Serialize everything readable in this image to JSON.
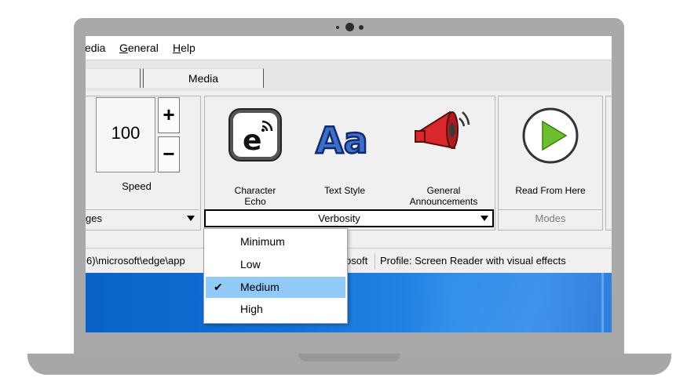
{
  "menu": [
    "edia",
    "General",
    "Help"
  ],
  "menu_underlines": [
    "",
    "G",
    "H"
  ],
  "menu_rest": [
    "edia",
    "eneral",
    "elp"
  ],
  "tabs": [
    "",
    "Media"
  ],
  "speed": {
    "value": "100",
    "plus": "+",
    "minus": "−",
    "label": "Speed",
    "group_footer": "ges"
  },
  "verbosity": {
    "items": [
      {
        "label_line1": "Character",
        "label_line2": "Echo",
        "icon": "character-echo-icon"
      },
      {
        "label_line1": "Text Style",
        "label_line2": "",
        "icon": "text-style-icon"
      },
      {
        "label_line1": "General",
        "label_line2": "Announcements",
        "icon": "megaphone-icon"
      }
    ],
    "footer": "Verbosity"
  },
  "modes": {
    "button_label": "Read From Here",
    "footer": "Modes",
    "icon": "play-icon"
  },
  "status": {
    "path": "6)\\microsoft\\edge\\app",
    "app": "osoft",
    "profile": "Profile: Screen Reader with visual effects"
  },
  "dropdown": {
    "options": [
      "Minimum",
      "Low",
      "Medium",
      "High"
    ],
    "selected": "Medium",
    "check_glyph": "✔"
  },
  "colors": {
    "accent_selected": "#91c9f7",
    "play_green": "#6cbf2f",
    "megaphone_red": "#d8282b",
    "desktop_blue": "#0a62c7"
  }
}
